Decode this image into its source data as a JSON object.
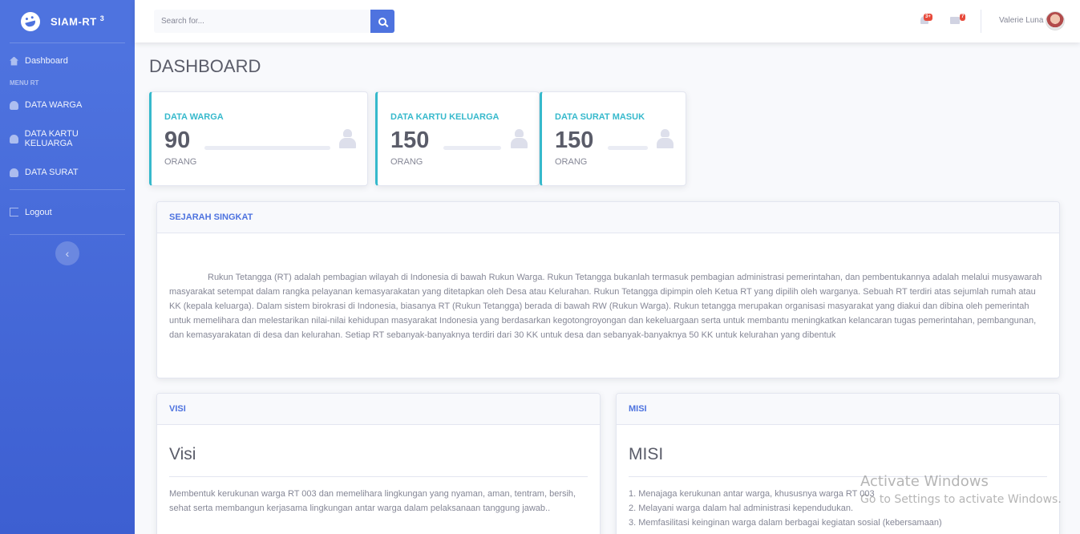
{
  "sidebar": {
    "brand": "SIAM-RT",
    "brand_sup": "3",
    "items": [
      {
        "label": "Dashboard",
        "icon": "home-icon"
      },
      {
        "label": "DATA WARGA",
        "icon": "tachometer-icon"
      },
      {
        "label": "DATA KARTU KELUARGA",
        "icon": "tachometer-icon"
      },
      {
        "label": "DATA SURAT",
        "icon": "tachometer-icon"
      },
      {
        "label": "Logout",
        "icon": "sign-out-icon"
      }
    ],
    "heading": "MENU RT",
    "toggle_glyph": "‹"
  },
  "topbar": {
    "search_placeholder": "Search for...",
    "alerts_badge": "3+",
    "messages_badge": "7",
    "user_name": "Valerie Luna"
  },
  "page": {
    "title": "DASHBOARD"
  },
  "stats": [
    {
      "label": "DATA WARGA",
      "value": "90",
      "unit": "ORANG"
    },
    {
      "label": "DATA KARTU KELUARGA",
      "value": "150",
      "unit": "ORANG"
    },
    {
      "label": "DATA SURAT MASUK",
      "value": "150",
      "unit": "ORANG"
    }
  ],
  "sejarah": {
    "header": "SEJARAH SINGKAT",
    "text": "Rukun Tetangga (RT) adalah pembagian wilayah di Indonesia di bawah Rukun Warga. Rukun Tetangga bukanlah termasuk pembagian administrasi pemerintahan, dan pembentukannya adalah melalui musyawarah masyarakat setempat dalam rangka pelayanan kemasyarakatan yang ditetapkan oleh Desa atau Kelurahan. Rukun Tetangga dipimpin oleh Ketua RT yang dipilih oleh warganya. Sebuah RT terdiri atas sejumlah rumah atau KK (kepala keluarga). Dalam sistem birokrasi di Indonesia, biasanya RT (Rukun Tetangga) berada di bawah RW (Rukun Warga). Rukun tetangga merupakan organisasi masyarakat yang diakui dan dibina oleh pemerintah untuk memelihara dan melestarikan nilai-nilai kehidupan masyarakat Indonesia yang berdasarkan kegotongroyongan dan kekeluargaan serta untuk membantu meningkatkan kelancaran tugas pemerintahan, pembangunan, dan kemasyarakatan di desa dan kelurahan. Setiap RT sebanyak-banyaknya terdiri dari 30 KK untuk desa dan sebanyak-banyaknya 50 KK untuk kelurahan yang dibentuk"
  },
  "visi": {
    "header": "VISI",
    "title": "Visi",
    "text": "Membentuk kerukunan warga RT 003 dan memelihara lingkungan yang nyaman, aman, tentram, bersih, sehat serta membangun kerjasama lingkungan antar warga dalam pelaksanaan tanggung jawab.."
  },
  "misi": {
    "header": "MISI",
    "title": "MISI",
    "items": [
      "1. Menajaga kerukunan antar warga, khususnya warga RT 003",
      "2. Melayani warga dalam hal administrasi kependudukan.",
      "3. Memfasilitasi keinginan warga dalam berbagai kegiatan sosial (kebersamaan)"
    ]
  },
  "watermark": {
    "line1": "Activate Windows",
    "line2": "Go to Settings to activate Windows."
  },
  "colors": {
    "primary": "#4e73df",
    "info": "#36b9cc",
    "danger": "#e74a3b"
  }
}
